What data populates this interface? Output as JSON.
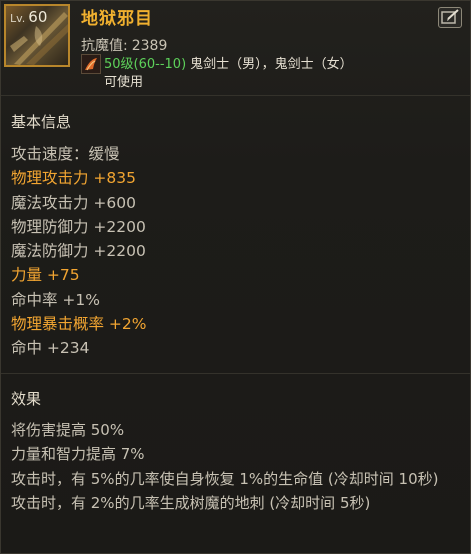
{
  "item": {
    "level_prefix": "Lv.",
    "level": "60",
    "name": "地狱邪目",
    "anti_magic_label": "抗魔值:",
    "anti_magic_value": "2389",
    "required_level": "50级(60--10)",
    "classes": "鬼剑士（男），鬼剑士（女）",
    "usable": "可使用"
  },
  "basic_info": {
    "title": "基本信息",
    "stats": [
      {
        "text": "攻击速度：缓慢",
        "highlight": false
      },
      {
        "text": "物理攻击力 +835",
        "highlight": true
      },
      {
        "text": "魔法攻击力 +600",
        "highlight": false
      },
      {
        "text": "物理防御力 +2200",
        "highlight": false
      },
      {
        "text": "魔法防御力 +2200",
        "highlight": false
      },
      {
        "text": "力量 +75",
        "highlight": true
      },
      {
        "text": "命中率 +1%",
        "highlight": false
      },
      {
        "text": "物理暴击概率 +2%",
        "highlight": true
      },
      {
        "text": "命中 +234",
        "highlight": false
      }
    ]
  },
  "effects": {
    "title": "效果",
    "lines": [
      "将伤害提高 50%",
      "力量和智力提高 7%",
      "攻击时，有 5%的几率使自身恢复 1%的生命值 (冷却时间 10秒)",
      "攻击时，有 2%的几率生成树魔的地刺 (冷却时间 5秒)"
    ]
  },
  "icons": {
    "item": "weapon-icon",
    "edit": "edit-icon",
    "class": "slayer-class-icon"
  },
  "colors": {
    "name": "#f1b12f",
    "highlight_stat": "#f2a531",
    "required_level": "#5dd15a"
  }
}
